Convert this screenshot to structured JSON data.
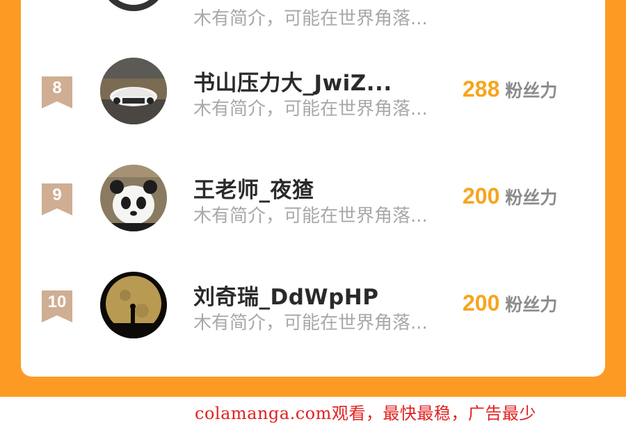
{
  "ranking": {
    "top_partial": {
      "bio": "木有简介，可能在世界角落..."
    },
    "rows": [
      {
        "rank": "8",
        "name": "书山压力大_JwiZ...",
        "bio": "木有简介，可能在世界角落...",
        "score": "288",
        "unit": "粉丝力"
      },
      {
        "rank": "9",
        "name": "王老师_夜猹",
        "bio": "木有简介，可能在世界角落...",
        "score": "200",
        "unit": "粉丝力"
      },
      {
        "rank": "10",
        "name": "刘奇瑞_DdWpHP",
        "bio": "木有简介，可能在世界角落...",
        "score": "200",
        "unit": "粉丝力"
      }
    ]
  },
  "footer": {
    "watermark": "colamanga.com观看，最快最稳，广告最少"
  },
  "colors": {
    "frame": "#fd9a24",
    "rank_badge": "#cfae93",
    "score": "#f6a51d",
    "watermark": "#e22020"
  }
}
